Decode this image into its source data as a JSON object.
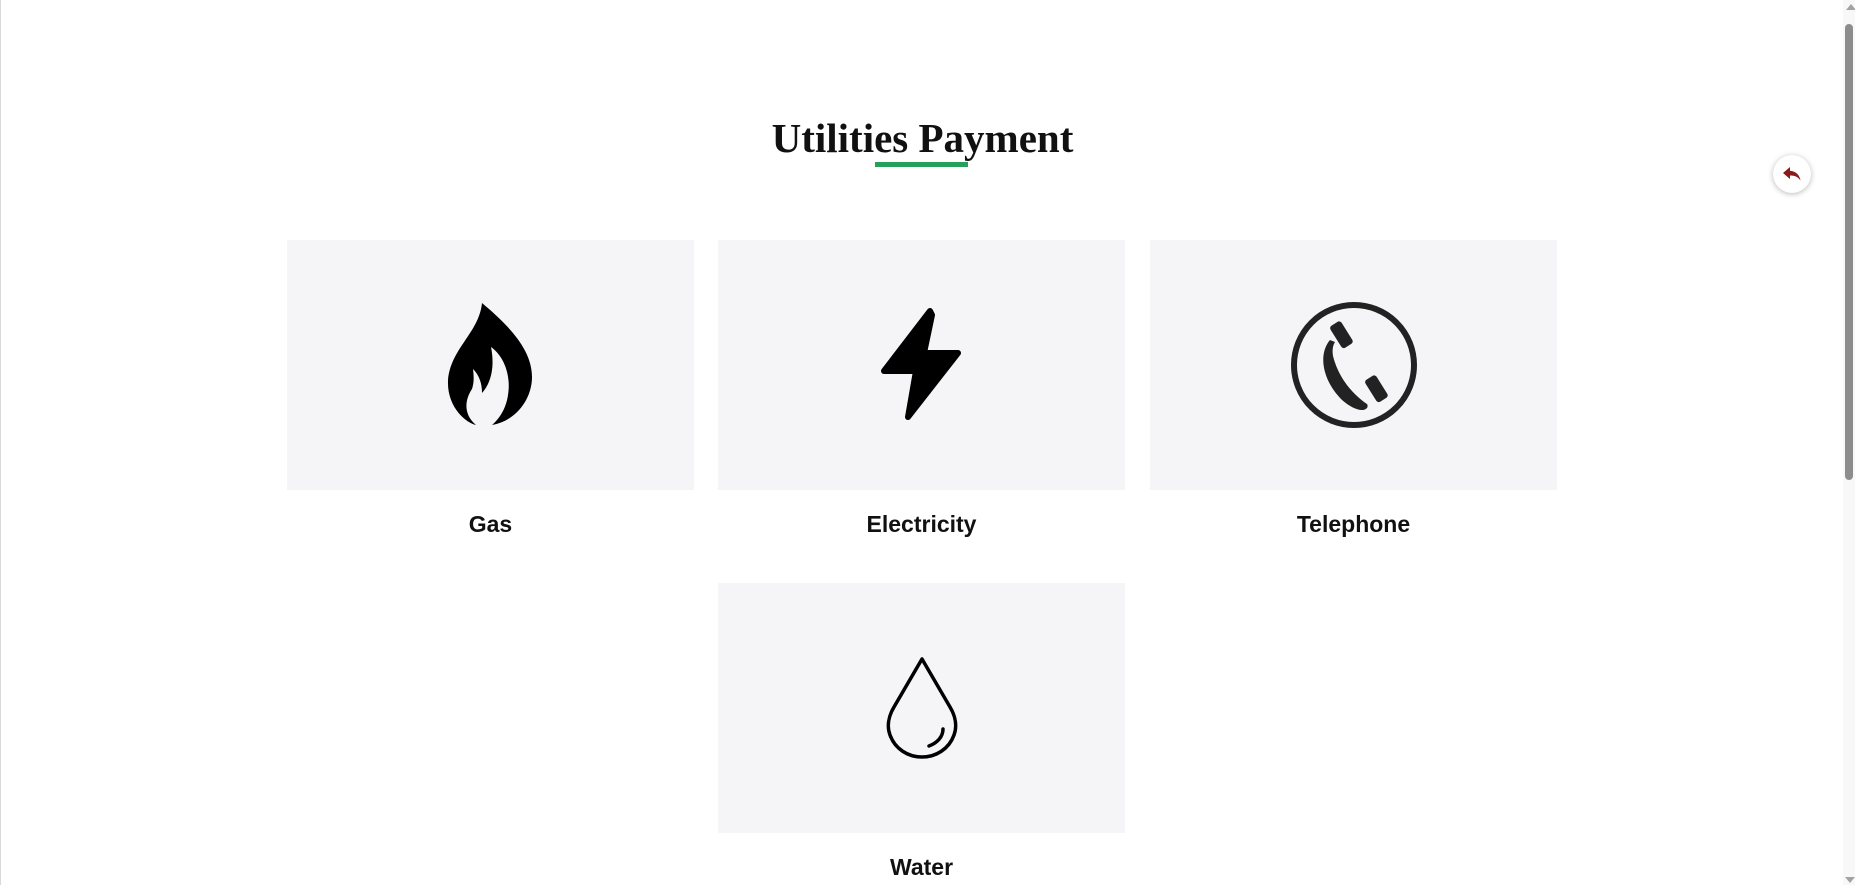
{
  "page": {
    "title": "Utilities Payment",
    "accent_color": "#27a05a",
    "back_button": {
      "icon": "reply-arrow-icon",
      "color": "#8b1a1a"
    }
  },
  "utilities": [
    {
      "label": "Gas",
      "icon": "flame-icon"
    },
    {
      "label": "Electricity",
      "icon": "lightning-bolt-icon"
    },
    {
      "label": "Telephone",
      "icon": "telephone-icon"
    },
    {
      "label": "Water",
      "icon": "water-drop-icon"
    }
  ]
}
